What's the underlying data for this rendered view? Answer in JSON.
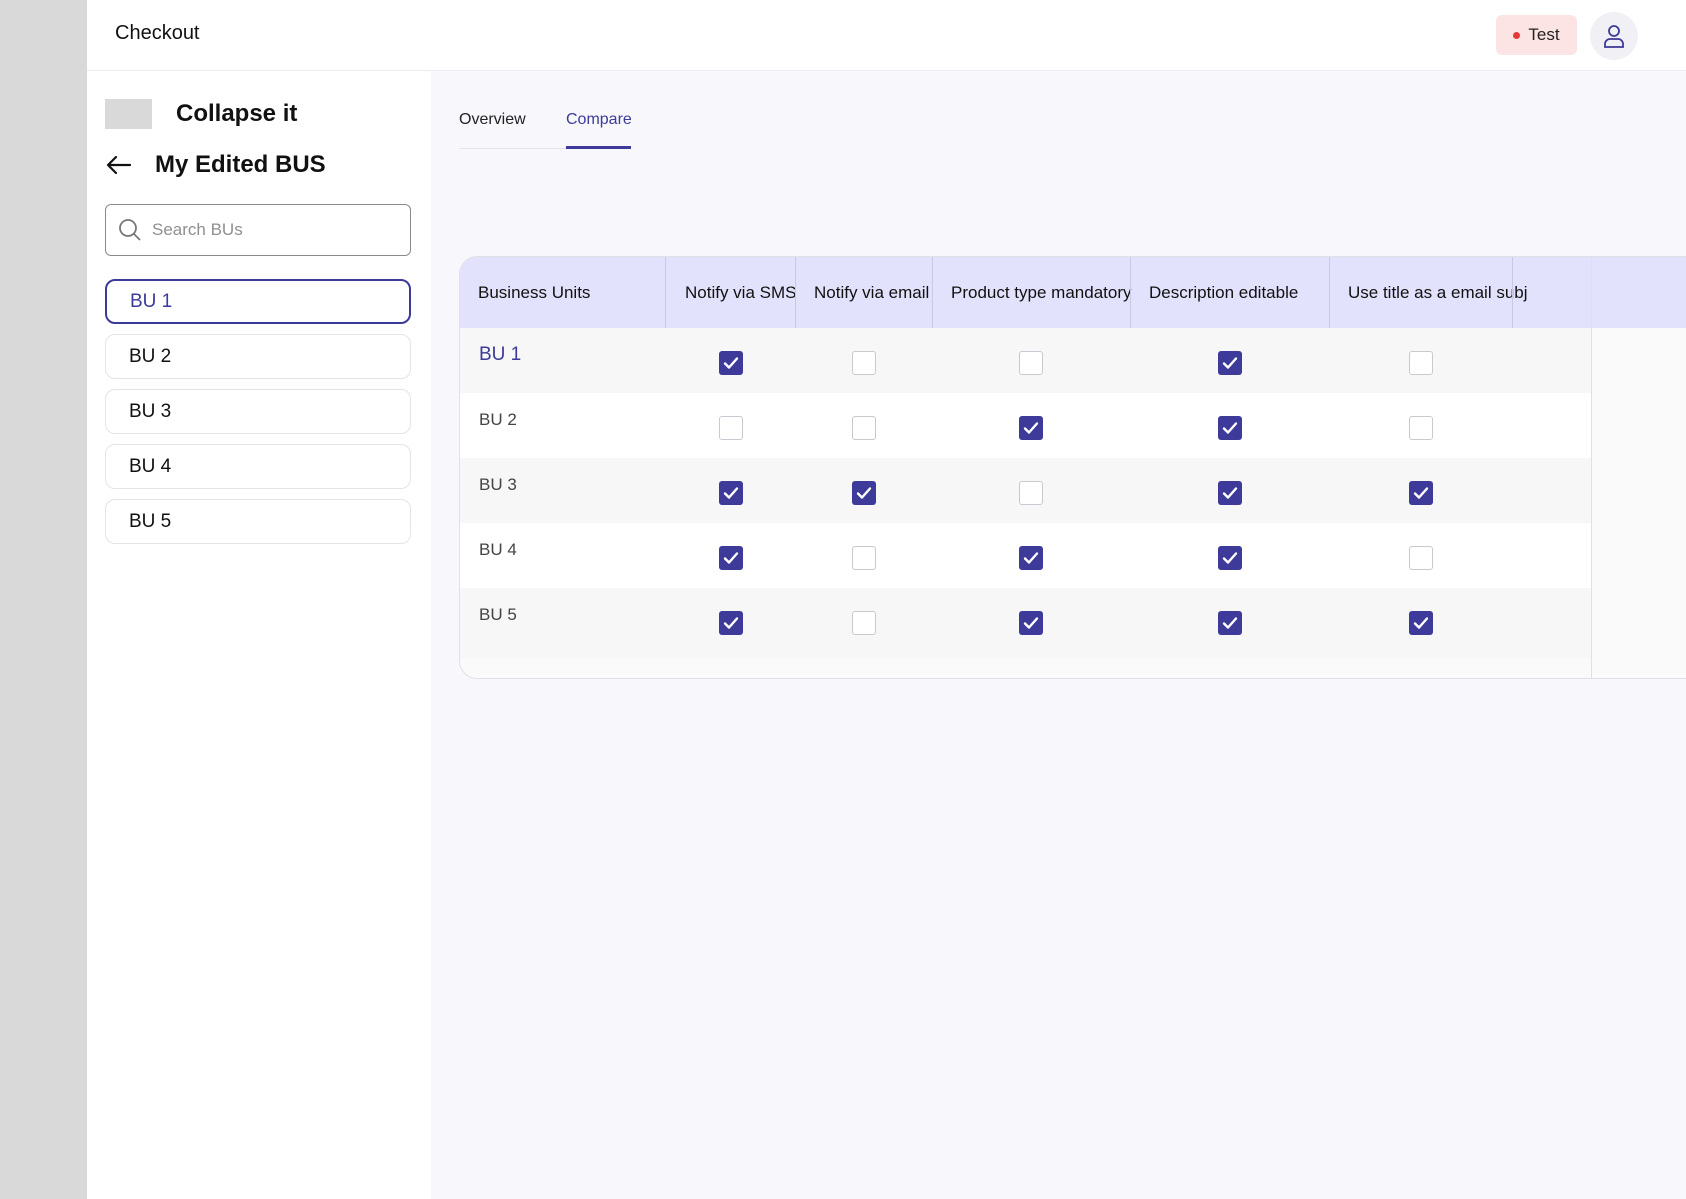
{
  "app": {
    "title": "Checkout"
  },
  "env_badge": {
    "label": "Test",
    "dot_color": "#e53935"
  },
  "sidebar": {
    "collapse_label": "Collapse it",
    "title": "My Edited BUS",
    "search_placeholder": "Search BUs",
    "items": [
      {
        "label": "BU 1",
        "active": true
      },
      {
        "label": "BU 2",
        "active": false
      },
      {
        "label": "BU 3",
        "active": false
      },
      {
        "label": "BU 4",
        "active": false
      },
      {
        "label": "BU 5",
        "active": false
      }
    ]
  },
  "tabs": [
    {
      "label": "Overview",
      "selected": false
    },
    {
      "label": "Compare",
      "selected": true
    }
  ],
  "table": {
    "columns": [
      "Business Units",
      "Notify via  SMS",
      "Notify via email",
      "Product type mandatory",
      "Description editable",
      "Use title as a email subj"
    ],
    "rows": [
      {
        "label": "BU 1",
        "values": [
          true,
          false,
          false,
          true,
          false
        ]
      },
      {
        "label": "BU 2",
        "values": [
          false,
          false,
          true,
          true,
          false
        ]
      },
      {
        "label": "BU 3",
        "values": [
          true,
          true,
          false,
          true,
          true
        ]
      },
      {
        "label": "BU 4",
        "values": [
          true,
          false,
          true,
          true,
          false
        ]
      },
      {
        "label": "BU 5",
        "values": [
          true,
          false,
          true,
          true,
          true
        ]
      }
    ]
  },
  "colors": {
    "accent": "#3d3a99",
    "header_bg": "#e3e2fd",
    "badge_bg": "#fde4e4"
  }
}
